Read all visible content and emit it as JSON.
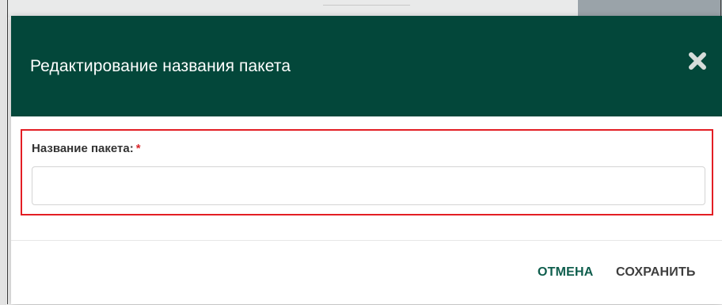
{
  "modal": {
    "title": "Редактирование названия пакета",
    "close_icon": "close-icon"
  },
  "form": {
    "field_label": "Название пакета:",
    "required_marker": "*",
    "input_value": "",
    "input_placeholder": ""
  },
  "footer": {
    "cancel_label": "ОТМЕНА",
    "save_label": "СОХРАНИТЬ"
  },
  "colors": {
    "header_background": "#03473a",
    "highlight_border": "#e31e24",
    "required_marker": "#d9262b",
    "cancel_text": "#0f5e4d",
    "save_text": "#3e3e3e"
  }
}
